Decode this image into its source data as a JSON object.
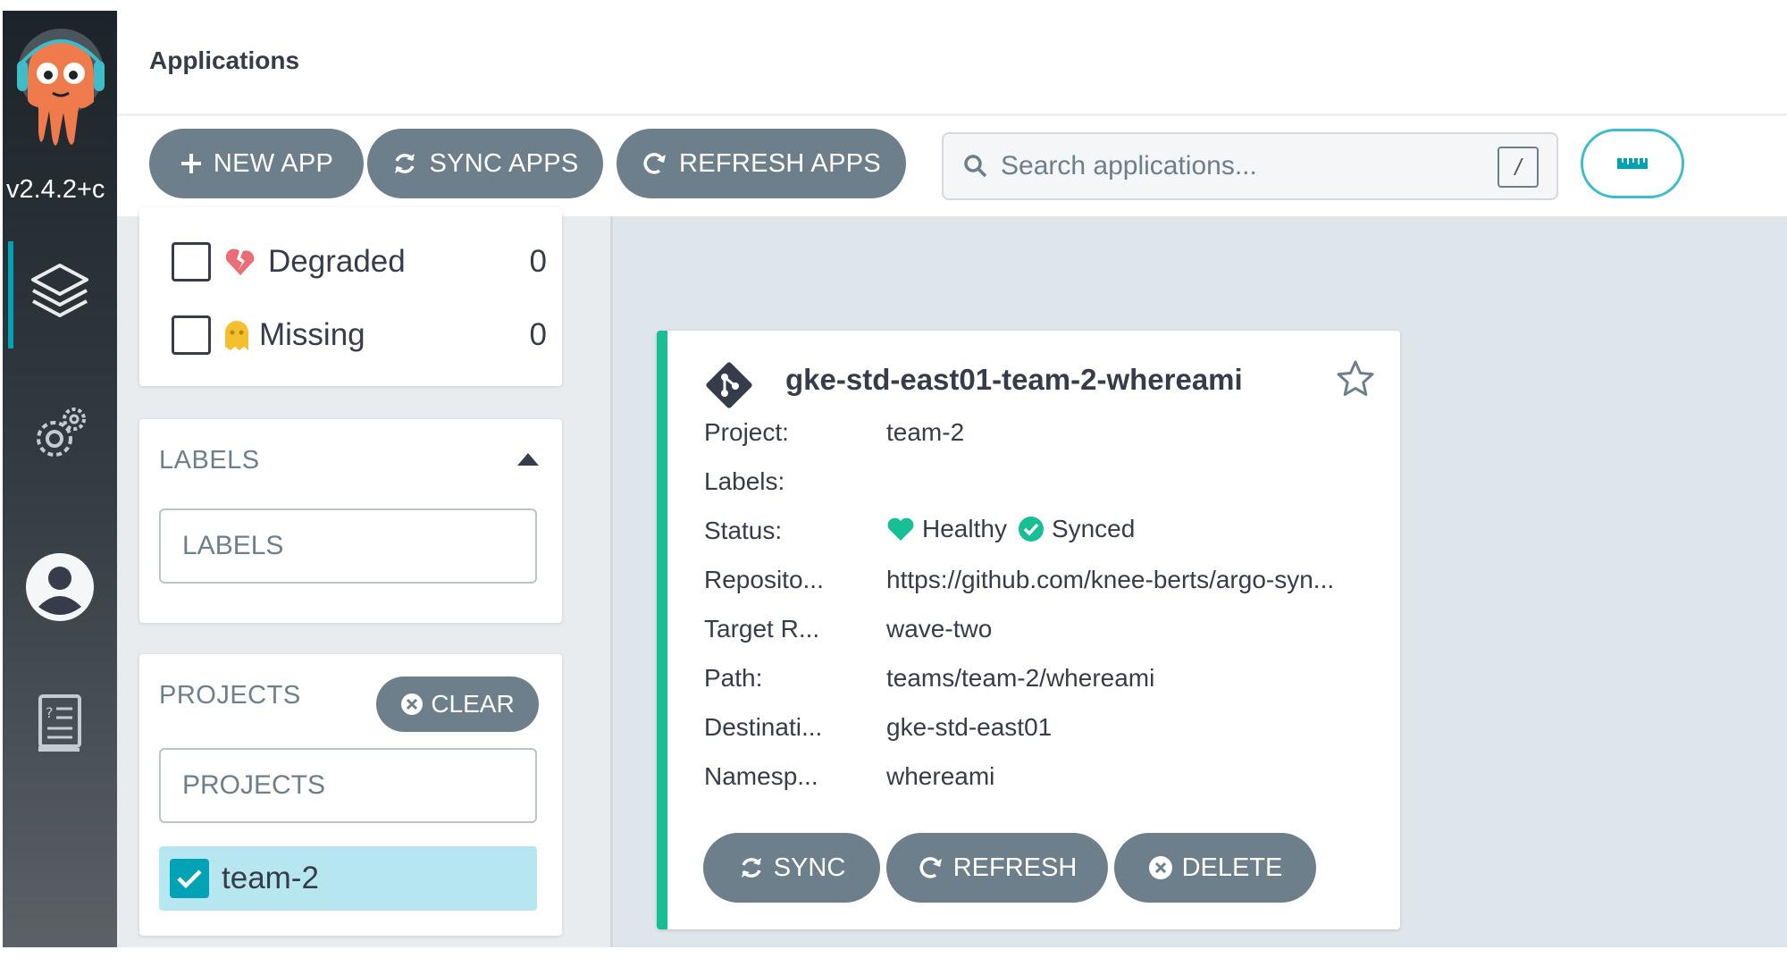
{
  "nav": {
    "version": "v2.4.2+c",
    "items": [
      {
        "name": "applications",
        "icon": "layers-icon"
      },
      {
        "name": "settings",
        "icon": "gears-icon"
      },
      {
        "name": "user-info",
        "icon": "user-icon"
      },
      {
        "name": "documentation",
        "icon": "book-icon"
      }
    ],
    "active_color": "#00a2b3"
  },
  "header": {
    "title": "Applications"
  },
  "toolbar": {
    "new_app": "NEW APP",
    "sync_apps": "SYNC APPS",
    "refresh_apps": "REFRESH APPS",
    "search_placeholder": "Search applications...",
    "search_shortcut": "/",
    "view_icon": "ruler-icon"
  },
  "filters": {
    "health": [
      {
        "label": "Degraded",
        "count": "0",
        "icon": "broken-heart-icon",
        "color": "#e96d76"
      },
      {
        "label": "Missing",
        "count": "0",
        "icon": "ghost-icon",
        "color": "#f4c030"
      }
    ],
    "labels": {
      "title": "LABELS",
      "placeholder": "LABELS"
    },
    "projects": {
      "title": "PROJECTS",
      "clear": "CLEAR",
      "placeholder": "PROJECTS",
      "items": [
        {
          "name": "team-2",
          "checked": true
        }
      ]
    }
  },
  "app_card": {
    "name": "gke-std-east01-team-2-whereami",
    "accent": "#18be94",
    "fields": [
      {
        "label": "Project:",
        "value": "team-2"
      },
      {
        "label": "Labels:",
        "value": ""
      },
      {
        "label": "Status:",
        "value": ""
      },
      {
        "label": "Reposito...",
        "value": "https://github.com/knee-berts/argo-syn..."
      },
      {
        "label": "Target R...",
        "value": "wave-two"
      },
      {
        "label": "Path:",
        "value": "teams/team-2/whereami"
      },
      {
        "label": "Destinati...",
        "value": "gke-std-east01"
      },
      {
        "label": "Namesp...",
        "value": "whereami"
      }
    ],
    "health": "Healthy",
    "sync": "Synced",
    "buttons": {
      "sync": "SYNC",
      "refresh": "REFRESH",
      "delete": "DELETE"
    }
  }
}
